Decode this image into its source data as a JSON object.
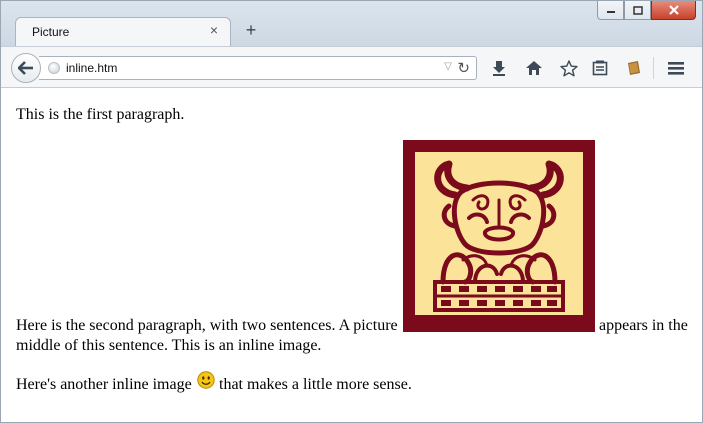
{
  "tab": {
    "title": "Picture",
    "close": "×"
  },
  "new_tab": "+",
  "urlbar": {
    "url": "inline.htm",
    "dropdown": "▽",
    "reload": "↻"
  },
  "content": {
    "p1": "This is the first paragraph.",
    "p2_before": "Here is the second paragraph, with two sentences. A picture",
    "p2_after": "appears in the",
    "p2_line2": "middle of this sentence. This is an inline image.",
    "p3_before": "Here's another inline image",
    "p3_after": "that makes a little more sense."
  },
  "icons": [
    "back-arrow-icon",
    "globe-icon",
    "reload-icon",
    "download-icon",
    "home-icon",
    "bookmark-star-icon",
    "reading-list-icon",
    "extension-icon",
    "menu-icon"
  ],
  "colors": {
    "bull_background": "#fbe49a",
    "bull_maroon": "#7a0a1c",
    "smiley": "#f5c518"
  }
}
